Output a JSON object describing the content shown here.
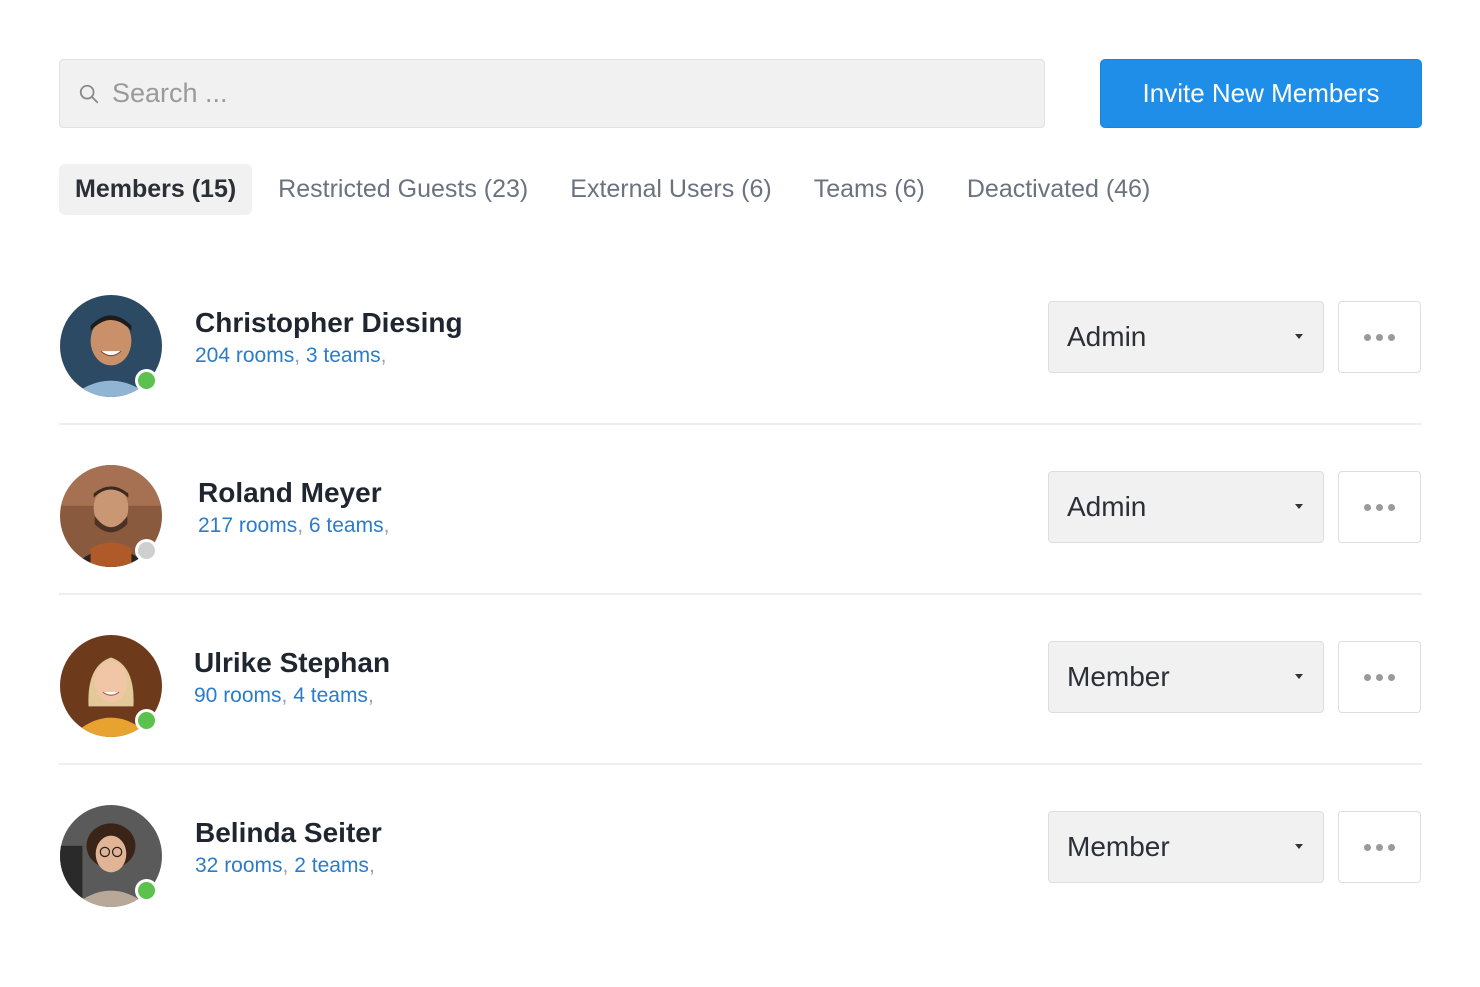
{
  "search": {
    "placeholder": "Search ...",
    "icon": "search-icon"
  },
  "toolbar": {
    "invite_label": "Invite New Members",
    "accent_color": "#1e8ee8"
  },
  "tabs": [
    {
      "label": "Members (15)",
      "active": true
    },
    {
      "label": "Restricted Guests (23)",
      "active": false
    },
    {
      "label": "External Users (6)",
      "active": false
    },
    {
      "label": "Teams (6)",
      "active": false
    },
    {
      "label": "Deactivated (46)",
      "active": false
    }
  ],
  "members": [
    {
      "name": "Christopher Diesing",
      "rooms": "204 rooms",
      "teams": "3 teams",
      "role": "Admin",
      "status": "online",
      "status_color": "#5cc24e"
    },
    {
      "name": "Roland Meyer",
      "rooms": "217 rooms",
      "teams": "6 teams",
      "role": "Admin",
      "status": "offline",
      "status_color": "#cfcfcf"
    },
    {
      "name": "Ulrike Stephan",
      "rooms": "90 rooms",
      "teams": "4 teams",
      "role": "Member",
      "status": "online",
      "status_color": "#5cc24e"
    },
    {
      "name": "Belinda Seiter",
      "rooms": "32 rooms",
      "teams": "2 teams",
      "role": "Member",
      "status": "online",
      "status_color": "#5cc24e"
    }
  ],
  "separator": ","
}
